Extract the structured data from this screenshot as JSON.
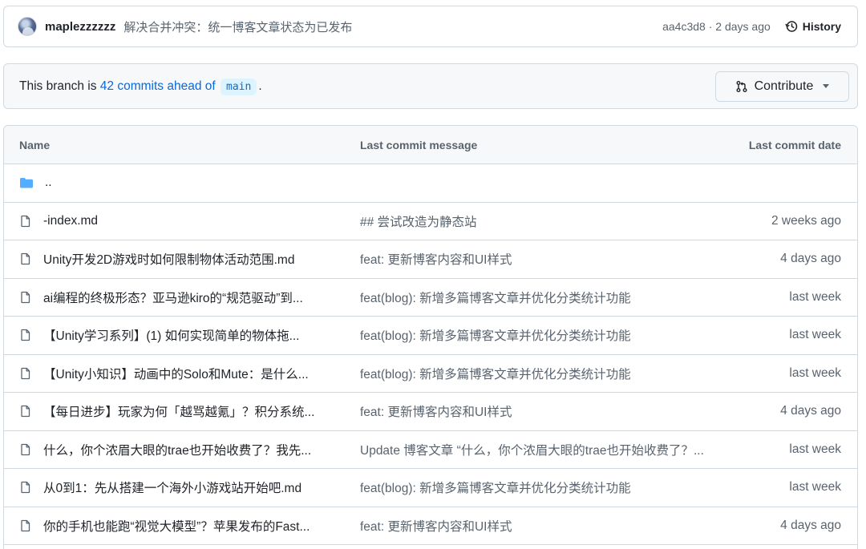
{
  "commit": {
    "author": "maplezzzzzz",
    "message": "解决合并冲突：统一博客文章状态为已发布",
    "meta": "aa4c3d8 · 2 days ago",
    "history_label": "History"
  },
  "branch": {
    "prefix": "This branch is ",
    "ahead_link": "42 commits ahead of",
    "base": "main",
    "suffix": ".",
    "contribute_label": "Contribute"
  },
  "table": {
    "headers": {
      "name": "Name",
      "message": "Last commit message",
      "date": "Last commit date"
    },
    "parent": "..",
    "rows": [
      {
        "name": "-index.md",
        "message": "## 尝试改造为静态站",
        "date": "2 weeks ago"
      },
      {
        "name": "Unity开发2D游戏时如何限制物体活动范围.md",
        "message": "feat: 更新博客内容和UI样式",
        "date": "4 days ago"
      },
      {
        "name": "ai编程的终极形态？亚马逊kiro的“规范驱动”到...",
        "message": "feat(blog): 新增多篇博客文章并优化分类统计功能",
        "date": "last week"
      },
      {
        "name": "【Unity学习系列】(1) 如何实现简单的物体拖...",
        "message": "feat(blog): 新增多篇博客文章并优化分类统计功能",
        "date": "last week"
      },
      {
        "name": "【Unity小知识】动画中的Solo和Mute：是什么...",
        "message": "feat(blog): 新增多篇博客文章并优化分类统计功能",
        "date": "last week"
      },
      {
        "name": "【每日进步】玩家为何「越骂越氪」？积分系统...",
        "message": "feat: 更新博客内容和UI样式",
        "date": "4 days ago"
      },
      {
        "name": "什么，你个浓眉大眼的trae也开始收费了？我先...",
        "message": "Update 博客文章 “什么，你个浓眉大眼的trae也开始收费了？...",
        "date": "last week"
      },
      {
        "name": "从0到1：先从搭建一个海外小游戏站开始吧.md",
        "message": "feat(blog): 新增多篇博客文章并优化分类统计功能",
        "date": "last week"
      },
      {
        "name": "你的手机也能跑“视觉大模型”？苹果发布的Fast...",
        "message": "feat: 更新博客内容和UI样式",
        "date": "4 days ago"
      }
    ]
  }
}
